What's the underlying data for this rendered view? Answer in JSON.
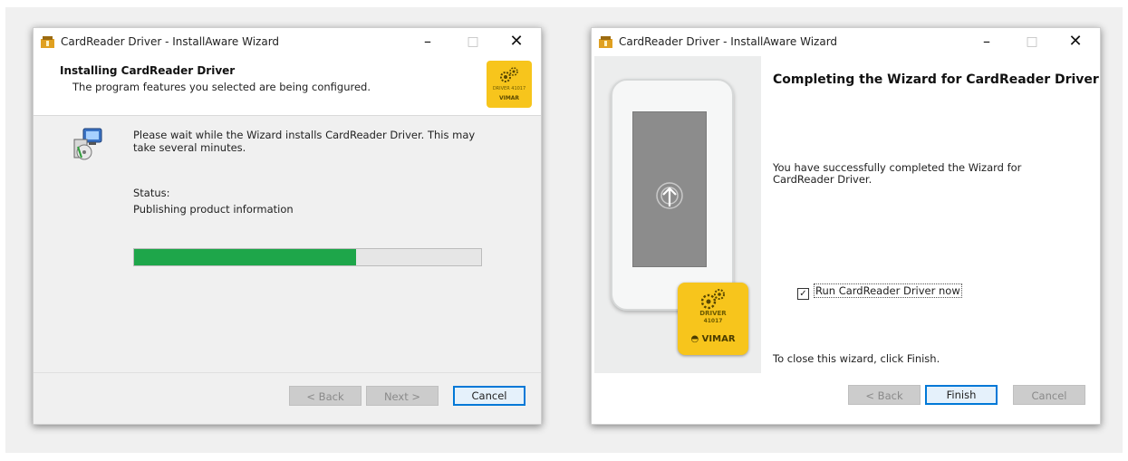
{
  "installing_window": {
    "title": "CardReader Driver - InstallAware Wizard",
    "controls": {
      "minimize": "–",
      "maximize": "□",
      "close": "✕"
    },
    "header_title": "Installing CardReader Driver",
    "header_subtitle": "The program features you selected are being configured.",
    "badge": {
      "line1": "DRIVER",
      "line2": "41017",
      "brand": "VIMAR"
    },
    "message": "Please wait while the  Wizard installs CardReader Driver. This may take several minutes.",
    "status_label": "Status:",
    "status_value": "Publishing product information",
    "progress_fraction": 0.64,
    "progress_color": "#1ea64a",
    "buttons": {
      "back": "< Back",
      "next": "Next >",
      "cancel": "Cancel"
    }
  },
  "completing_window": {
    "title": "CardReader Driver - InstallAware Wizard",
    "controls": {
      "minimize": "–",
      "maximize": "□",
      "close": "✕"
    },
    "heading": "Completing the  Wizard for CardReader Driver",
    "message": "You have successfully completed the  Wizard for CardReader Driver.",
    "checkbox_label": "Run CardReader Driver now",
    "checkbox_checked": true,
    "close_note": "To close this wizard, click Finish.",
    "badge": {
      "line1": "DRIVER",
      "line2": "41017",
      "brand": "VIMAR"
    },
    "buttons": {
      "back": "< Back",
      "finish": "Finish",
      "cancel": "Cancel"
    }
  },
  "colors": {
    "accent": "#0078d7",
    "vimar_yellow": "#f7c51c"
  }
}
